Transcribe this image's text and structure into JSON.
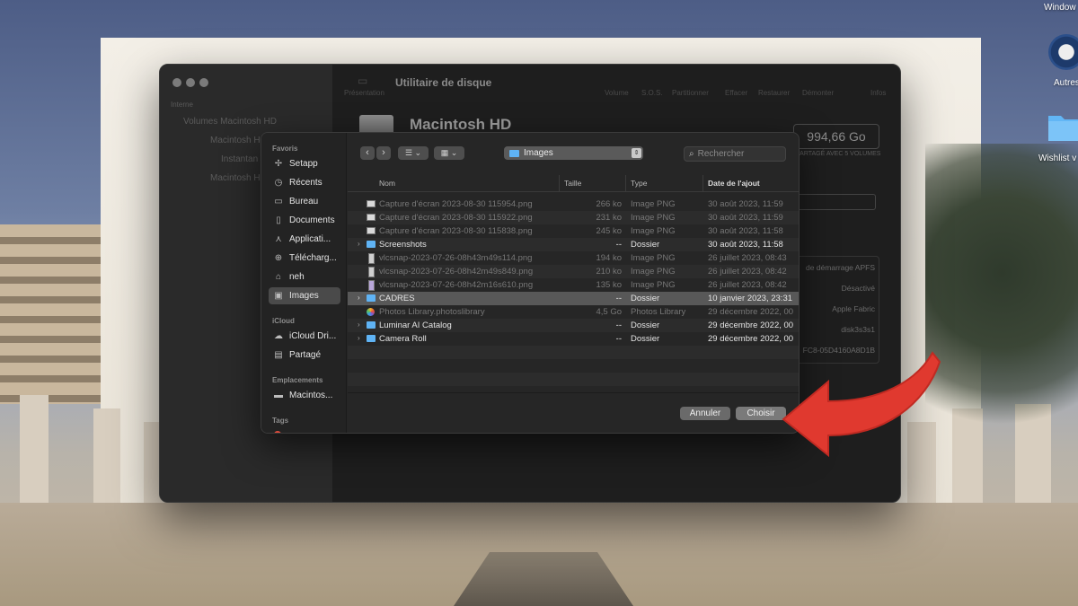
{
  "desktop": {
    "corner_label": "Window",
    "icon1_label": "Autres",
    "icon2_label": "Wishlist v",
    "arrow_color": "#e0392f"
  },
  "disk_utility": {
    "title": "Utilitaire de disque",
    "toolbar": {
      "presentation": "Présentation",
      "volume": "Volume",
      "sos": "S.O.S.",
      "partition": "Partitionner",
      "erase": "Effacer",
      "restore": "Restaurer",
      "unmount": "Démonter",
      "info": "Infos"
    },
    "sidebar": {
      "section": "Interne",
      "items": [
        "Volumes Macintosh HD",
        "Macintosh H",
        "Instantan",
        "Macintosh H"
      ]
    },
    "disk_name": "Macintosh HD",
    "capacity": "994,66 Go",
    "capacity_sub": "PARTAGÉ AVEC 5 VOLUMES",
    "info": [
      "de démarrage APFS",
      "Désactivé",
      "Apple Fabric",
      "disk3s3s1",
      "FC8-05D4160A8D1B"
    ]
  },
  "open_panel": {
    "sidebar": {
      "favorites_header": "Favoris",
      "favorites": [
        {
          "label": "Setapp",
          "icon": "setapp-icon"
        },
        {
          "label": "Récents",
          "icon": "clock-icon"
        },
        {
          "label": "Bureau",
          "icon": "desktop-icon"
        },
        {
          "label": "Documents",
          "icon": "document-icon"
        },
        {
          "label": "Applicati...",
          "icon": "applications-icon"
        },
        {
          "label": "Télécharg...",
          "icon": "download-icon"
        },
        {
          "label": "neh",
          "icon": "home-icon"
        },
        {
          "label": "Images",
          "icon": "images-icon"
        }
      ],
      "icloud_header": "iCloud",
      "icloud": [
        {
          "label": "iCloud Dri...",
          "icon": "cloud-icon"
        },
        {
          "label": "Partagé",
          "icon": "shared-folder-icon"
        }
      ],
      "locations_header": "Emplacements",
      "locations": [
        {
          "label": "Macintos...",
          "icon": "disk-icon"
        }
      ],
      "tags_header": "Tags",
      "tag_color": "#e04b3c"
    },
    "toolbar": {
      "location": "Images",
      "search_placeholder": "Rechercher"
    },
    "columns": {
      "name": "Nom",
      "size": "Taille",
      "type": "Type",
      "date": "Date de l'ajout"
    },
    "rows": [
      {
        "name": "Capture d'écran 2023-08-30 115954.png",
        "size": "266 ko",
        "type": "Image PNG",
        "date": "30 août 2023, 11:59"
      },
      {
        "name": "Capture d'écran 2023-08-30 115922.png",
        "size": "231 ko",
        "type": "Image PNG",
        "date": "30 août 2023, 11:59"
      },
      {
        "name": "Capture d'écran 2023-08-30 115838.png",
        "size": "245 ko",
        "type": "Image PNG",
        "date": "30 août 2023, 11:58"
      },
      {
        "name": "Screenshots",
        "size": "--",
        "type": "Dossier",
        "date": "30 août 2023, 11:58"
      },
      {
        "name": "vlcsnap-2023-07-26-08h43m49s114.png",
        "size": "194 ko",
        "type": "Image PNG",
        "date": "26 juillet 2023, 08:43"
      },
      {
        "name": "vlcsnap-2023-07-26-08h42m49s849.png",
        "size": "210 ko",
        "type": "Image PNG",
        "date": "26 juillet 2023, 08:42"
      },
      {
        "name": "vlcsnap-2023-07-26-08h42m16s610.png",
        "size": "135 ko",
        "type": "Image PNG",
        "date": "26 juillet 2023, 08:42"
      },
      {
        "name": "CADRES",
        "size": "--",
        "type": "Dossier",
        "date": "10 janvier 2023, 23:31"
      },
      {
        "name": "Photos Library.photoslibrary",
        "size": "4,5 Go",
        "type": "Photos Library",
        "date": "29 décembre 2022, 00"
      },
      {
        "name": "Luminar AI Catalog",
        "size": "--",
        "type": "Dossier",
        "date": "29 décembre 2022, 00"
      },
      {
        "name": "Camera Roll",
        "size": "--",
        "type": "Dossier",
        "date": "29 décembre 2022, 00"
      }
    ],
    "buttons": {
      "cancel": "Annuler",
      "choose": "Choisir"
    }
  }
}
